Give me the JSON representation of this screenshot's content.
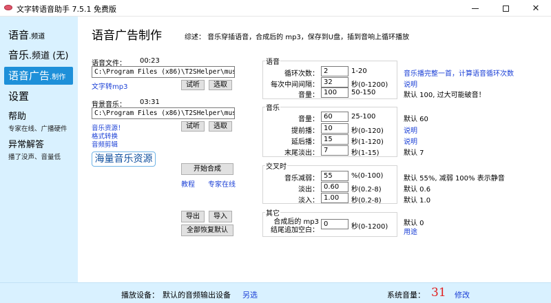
{
  "window": {
    "title": "文字转语音助手 7.5.1 免费版",
    "minimize": "",
    "maximize": "",
    "close": "✕"
  },
  "sidebar": {
    "items": [
      {
        "label": "语音",
        "suffix": ".频道"
      },
      {
        "label": "音乐",
        "suffix": ".频道 (无)"
      },
      {
        "label": "语音广告",
        "suffix": ".制作"
      },
      {
        "label": "设置",
        "suffix": ""
      },
      {
        "label": "帮助",
        "sub": "专家在线、广播硬件"
      },
      {
        "label": "异常解答",
        "sub": "播了没声、音量低"
      }
    ]
  },
  "main": {
    "title": "语音广告制作",
    "description": "综述：  音乐穿插语音，合成后的 mp3，保存到U盘，插到音响上循环播放",
    "voice_file": {
      "label": "语音文件：",
      "duration": "00:23",
      "path": "C:\\Program Files (x86)\\T2SHelper\\musics",
      "listen_button": "试听",
      "select_button": "选取",
      "link": "文字转mp3"
    },
    "bg_music": {
      "label": "背景音乐：",
      "duration": "03:31",
      "path": "C:\\Program Files (x86)\\T2SHelper\\musics",
      "listen_button": "试听",
      "select_button": "选取",
      "links": [
        "音乐资源！",
        "格式转换",
        "音频剪辑"
      ]
    },
    "massive_music_button": "海量音乐资源",
    "start_button": "开始合成",
    "tutorial_link": "教程",
    "expert_link": "专家在线",
    "export_button": "导出",
    "import_button": "导入",
    "reset_button": "全部恢复默认"
  },
  "groups": {
    "voice": {
      "title": "语音",
      "rows": [
        {
          "label": "循环次数：",
          "value": "2",
          "range": "1-20",
          "note": "音乐播完整一首，计算语音循环次数",
          "note_is_link": true
        },
        {
          "label": "每次中间间隔：",
          "value": "32",
          "range": "秒(0-1200)",
          "note": "说明",
          "note_is_link": true
        },
        {
          "label": "音量：",
          "value": "100",
          "range": "50-150",
          "note": "默认 100, 过大可能破音！",
          "note_is_link": false
        }
      ]
    },
    "music": {
      "title": "音乐",
      "rows": [
        {
          "label": "音量：",
          "value": "60",
          "range": "25-100",
          "note": "默认 60",
          "note_is_link": false
        },
        {
          "label": "提前播：",
          "value": "10",
          "range": "秒(0-120)",
          "note": "说明",
          "note_is_link": true
        },
        {
          "label": "延后播：",
          "value": "15",
          "range": "秒(1-120)",
          "note": "说明",
          "note_is_link": true
        },
        {
          "label": "末尾淡出：",
          "value": "7",
          "range": "秒(1-15)",
          "note": "默认 7",
          "note_is_link": false
        }
      ]
    },
    "crossfade": {
      "title": "交叉时",
      "rows": [
        {
          "label": "音乐减弱：",
          "value": "55",
          "range": "%(0-100)",
          "note": "默认 55%, 减弱 100% 表示静音",
          "note_is_link": false
        },
        {
          "label": "淡出：",
          "value": "0.60",
          "range": "秒(0.2-8)",
          "note": "默认 0.6",
          "note_is_link": false
        },
        {
          "label": "淡入：",
          "value": "1.00",
          "range": "秒(0.2-8)",
          "note": "默认 1.0",
          "note_is_link": false
        }
      ]
    },
    "other": {
      "title": "其它",
      "label_line1": "合成后的 mp3",
      "label_line2": "结尾追加空白：",
      "value": "0",
      "range": "秒(0-1200)",
      "note": "默认 0",
      "note_link": "用途"
    }
  },
  "statusbar": {
    "device_label": "播放设备：",
    "device_value": "默认的音频输出设备",
    "alt_link": "另选",
    "volume_label": "系统音量：",
    "volume_value": "31",
    "modify_link": "修改"
  }
}
